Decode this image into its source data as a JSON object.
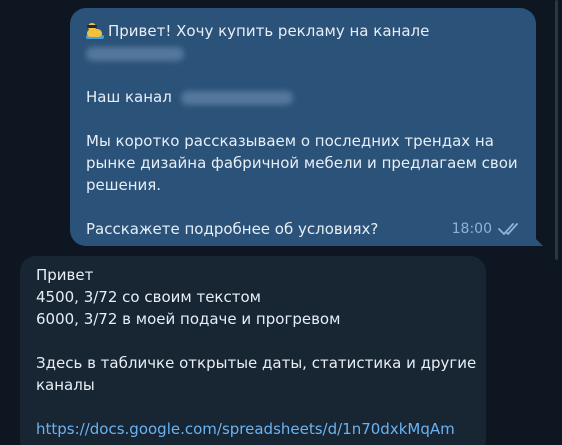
{
  "colors": {
    "background": "#0e1621",
    "outgoing_bubble": "#2b5278",
    "incoming_bubble": "#182533",
    "text": "#e7eef6",
    "link": "#6ab3f3",
    "meta": "#8eb3d5"
  },
  "outgoing": {
    "greeting": "Привет! Хочу купить рекламу на канале",
    "channel_prefix": "Наш канал",
    "p1_line1": "Мы коротко рассказываем о последних трендах на",
    "p1_line2": "рынке дизайна фабричной мебели и предлагаем свои",
    "p1_line3": "решения.",
    "question": "Расскажете подробнее об условиях?",
    "time": "18:00",
    "status_icon": "double-check-icon"
  },
  "incoming": {
    "line1": "Привет",
    "line2": "4500, 3/72 со своим текстом",
    "line3": "6000, 3/72 в моей подаче и прогревом",
    "line4": "Здесь в табличке открытые даты, статистика и другие",
    "line5": "каналы",
    "link": "https://docs.google.com/spreadsheets/d/1n70dxkMqAm"
  }
}
